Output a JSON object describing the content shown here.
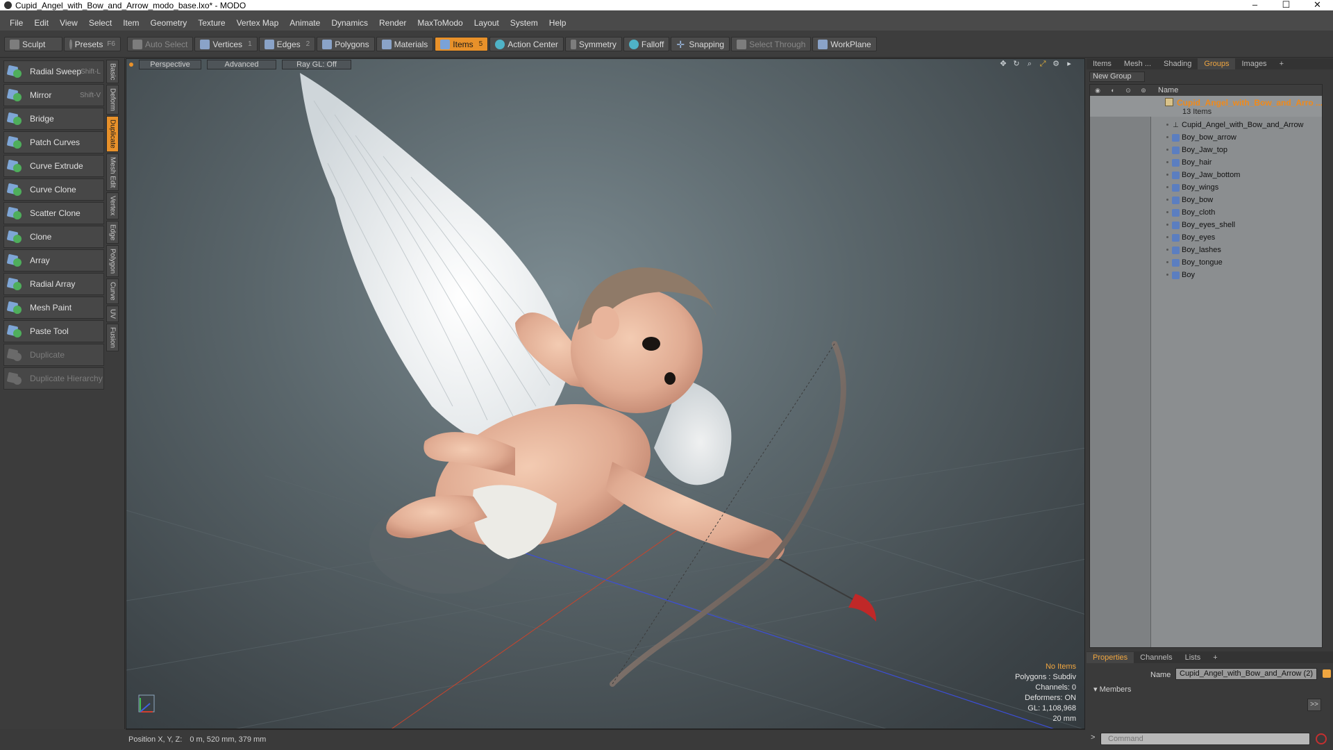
{
  "window": {
    "title": "Cupid_Angel_with_Bow_and_Arrow_modo_base.lxo* - MODO",
    "controls": [
      "–",
      "☐",
      "✕"
    ]
  },
  "menu": [
    "File",
    "Edit",
    "View",
    "Select",
    "Item",
    "Geometry",
    "Texture",
    "Vertex Map",
    "Animate",
    "Dynamics",
    "Render",
    "MaxToModo",
    "Layout",
    "System",
    "Help"
  ],
  "toolbar": {
    "sculpt": "Sculpt",
    "presets": "Presets",
    "presets_key": "F6",
    "auto_select": "Auto Select",
    "vertices": "Vertices",
    "vertices_count": "1",
    "edges": "Edges",
    "edges_count": "2",
    "polygons": "Polygons",
    "materials": "Materials",
    "items": "Items",
    "items_count": "5",
    "action_center": "Action Center",
    "symmetry": "Symmetry",
    "falloff": "Falloff",
    "snapping": "Snapping",
    "select_through": "Select Through",
    "workplane": "WorkPlane"
  },
  "tools": [
    {
      "label": "Radial Sweep",
      "key": "Shift-L",
      "enabled": true
    },
    {
      "label": "Mirror",
      "key": "Shift-V",
      "enabled": true
    },
    {
      "label": "Bridge",
      "key": "",
      "enabled": true
    },
    {
      "label": "Patch Curves",
      "key": "",
      "enabled": true
    },
    {
      "label": "Curve Extrude",
      "key": "",
      "enabled": true
    },
    {
      "label": "Curve Clone",
      "key": "",
      "enabled": true
    },
    {
      "label": "Scatter Clone",
      "key": "",
      "enabled": true
    },
    {
      "label": "Clone",
      "key": "",
      "enabled": true
    },
    {
      "label": "Array",
      "key": "",
      "enabled": true
    },
    {
      "label": "Radial Array",
      "key": "",
      "enabled": true
    },
    {
      "label": "Mesh Paint",
      "key": "",
      "enabled": true
    },
    {
      "label": "Paste Tool",
      "key": "",
      "enabled": true
    },
    {
      "label": "Duplicate",
      "key": "",
      "enabled": false
    },
    {
      "label": "Duplicate Hierarchy",
      "key": "",
      "enabled": false
    }
  ],
  "vtabs": [
    {
      "label": "Basic",
      "active": false
    },
    {
      "label": "Deform",
      "active": false
    },
    {
      "label": "Duplicate",
      "active": true
    },
    {
      "label": "Mesh Edit",
      "active": false
    },
    {
      "label": "Vertex",
      "active": false
    },
    {
      "label": "Edge",
      "active": false
    },
    {
      "label": "Polygon",
      "active": false
    },
    {
      "label": "Curve",
      "active": false
    },
    {
      "label": "UV",
      "active": false
    },
    {
      "label": "Fusion",
      "active": false
    }
  ],
  "viewport": {
    "view_mode": "Perspective",
    "shading": "Advanced",
    "raygl": "Ray GL: Off",
    "info": {
      "selection": "No Items",
      "polygons": "Polygons : Subdiv",
      "channels": "Channels: 0",
      "deformers": "Deformers: ON",
      "gl": "GL: 1,108,968",
      "scale": "20 mm"
    }
  },
  "right_panel": {
    "tabs": [
      {
        "label": "Items",
        "active": false
      },
      {
        "label": "Mesh ...",
        "active": false
      },
      {
        "label": "Shading",
        "active": false
      },
      {
        "label": "Groups",
        "active": true
      },
      {
        "label": "Images",
        "active": false
      },
      {
        "label": "+",
        "active": false
      }
    ],
    "new_group": "New Group",
    "name_header": "Name",
    "group": {
      "name": "Cupid_Angel_with_Bow_and_Arro ...",
      "count": "13 Items"
    },
    "items": [
      {
        "label": "Cupid_Angel_with_Bow_and_Arrow",
        "type": "locator"
      },
      {
        "label": "Boy_bow_arrow",
        "type": "mesh"
      },
      {
        "label": "Boy_Jaw_top",
        "type": "mesh"
      },
      {
        "label": "Boy_hair",
        "type": "mesh"
      },
      {
        "label": "Boy_Jaw_bottom",
        "type": "mesh"
      },
      {
        "label": "Boy_wings",
        "type": "mesh"
      },
      {
        "label": "Boy_bow",
        "type": "mesh"
      },
      {
        "label": "Boy_cloth",
        "type": "mesh"
      },
      {
        "label": "Boy_eyes_shell",
        "type": "mesh"
      },
      {
        "label": "Boy_eyes",
        "type": "mesh"
      },
      {
        "label": "Boy_lashes",
        "type": "mesh"
      },
      {
        "label": "Boy_tongue",
        "type": "mesh"
      },
      {
        "label": "Boy",
        "type": "mesh"
      }
    ]
  },
  "properties": {
    "tabs": [
      {
        "label": "Properties",
        "active": true
      },
      {
        "label": "Channels",
        "active": false
      },
      {
        "label": "Lists",
        "active": false
      },
      {
        "label": "+",
        "active": false
      }
    ],
    "name_label": "Name",
    "name_value": "Cupid_Angel_with_Bow_and_Arrow (2)",
    "members": "Members",
    "more": ">>"
  },
  "status": {
    "position_label": "Position X, Y, Z:",
    "position_value": "0 m, 520 mm, 379 mm"
  },
  "command": {
    "prompt": ">",
    "placeholder": "Command"
  },
  "colors": {
    "accent": "#e8912a",
    "group_name": "#f08a1a"
  }
}
